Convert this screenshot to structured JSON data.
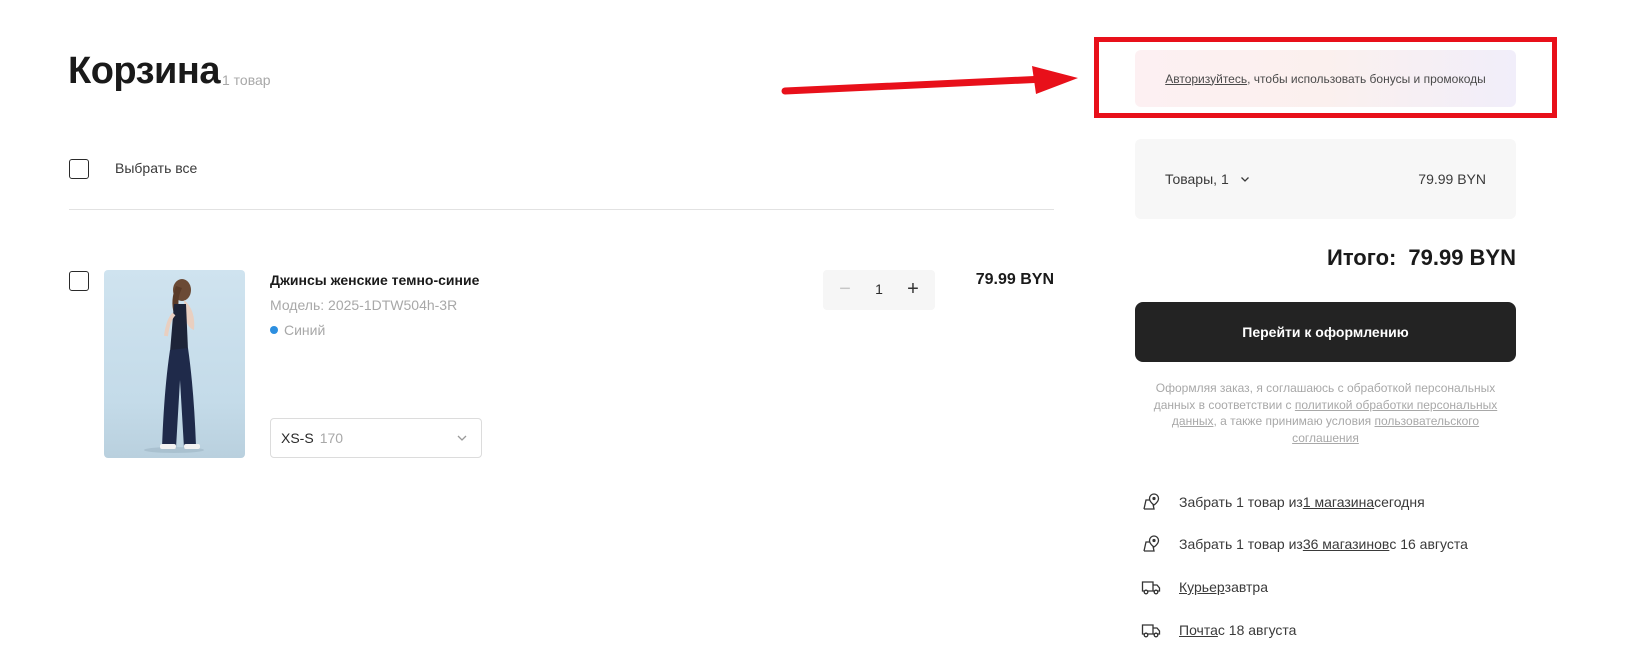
{
  "cart": {
    "title": "Корзина",
    "count": "1 товар",
    "select_all_label": "Выбрать все"
  },
  "item": {
    "name": "Джинсы женские темно-синие",
    "model": "Модель: 2025-1DTW504h-3R",
    "color_label": "Синий",
    "color_hex": "#2d8fe0",
    "size_main": "XS-S",
    "size_sub": "170",
    "quantity": "1",
    "minus_label": "−",
    "plus_label": "+",
    "price": "79.99 BYN"
  },
  "promo": {
    "link": "Авторизуйтесь",
    "text": ", чтобы использовать бонусы и промокоды"
  },
  "summary": {
    "items_label": "Товары, 1",
    "items_price": "79.99 BYN",
    "total_label": "Итого:",
    "total_value": "79.99 BYN",
    "checkout_label": "Перейти к оформлению"
  },
  "consent": {
    "text1": "Оформляя заказ, я соглашаюсь с обработкой персональных данных в соответствии с ",
    "link1": "политикой обработки персональных данных",
    "text2": ", а также принимаю условия ",
    "link2": "пользовательского соглашения"
  },
  "delivery": [
    {
      "icon": "store-pin-icon",
      "prefix": "Забрать 1 товар из ",
      "link": "1 магазина",
      "suffix": " сегодня"
    },
    {
      "icon": "store-pin-icon",
      "prefix": "Забрать 1 товар из ",
      "link": "36 магазинов",
      "suffix": " с 16 августа"
    },
    {
      "icon": "truck-icon",
      "prefix": "",
      "link": "Курьер",
      "suffix": " завтра"
    },
    {
      "icon": "truck-icon",
      "prefix": "",
      "link": "Почта",
      "suffix": " с 18 августа"
    }
  ],
  "annotation": {
    "arrow_color": "#e8101a",
    "frame_color": "#e8101a"
  }
}
